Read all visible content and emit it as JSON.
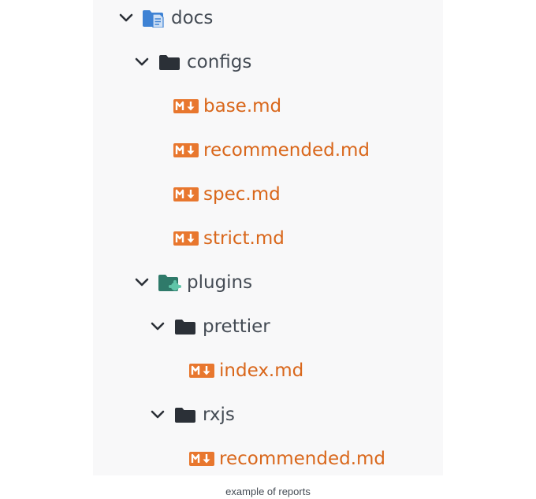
{
  "colors": {
    "panel_background": "#f8f8f9",
    "directory_text": "#444b54",
    "markdown_text": "#d9671b",
    "markdown_icon": "#e8772e",
    "docs_folder_icon": "#3e82d4",
    "plugins_folder_icon": "#2f7a6a",
    "folder_icon": "#2b3037"
  },
  "tree": [
    {
      "label": "docs",
      "kind": "folder",
      "icon": "docs-folder-icon",
      "expanded": true,
      "depth": 0
    },
    {
      "label": "configs",
      "kind": "folder",
      "icon": "folder-icon",
      "expanded": true,
      "depth": 1
    },
    {
      "label": "base.md",
      "kind": "markdown",
      "icon": "markdown-icon",
      "depth": 2
    },
    {
      "label": "recommended.md",
      "kind": "markdown",
      "icon": "markdown-icon",
      "depth": 2
    },
    {
      "label": "spec.md",
      "kind": "markdown",
      "icon": "markdown-icon",
      "depth": 2
    },
    {
      "label": "strict.md",
      "kind": "markdown",
      "icon": "markdown-icon",
      "depth": 2
    },
    {
      "label": "plugins",
      "kind": "folder",
      "icon": "plugins-folder-icon",
      "expanded": true,
      "depth": 1
    },
    {
      "label": "prettier",
      "kind": "folder",
      "icon": "folder-icon",
      "expanded": true,
      "depth": 2
    },
    {
      "label": "index.md",
      "kind": "markdown",
      "icon": "markdown-icon",
      "depth": 3
    },
    {
      "label": "rxjs",
      "kind": "folder",
      "icon": "folder-icon",
      "expanded": true,
      "depth": 2
    },
    {
      "label": "recommended.md",
      "kind": "markdown",
      "icon": "markdown-icon",
      "depth": 3
    }
  ],
  "caption": "example of reports"
}
